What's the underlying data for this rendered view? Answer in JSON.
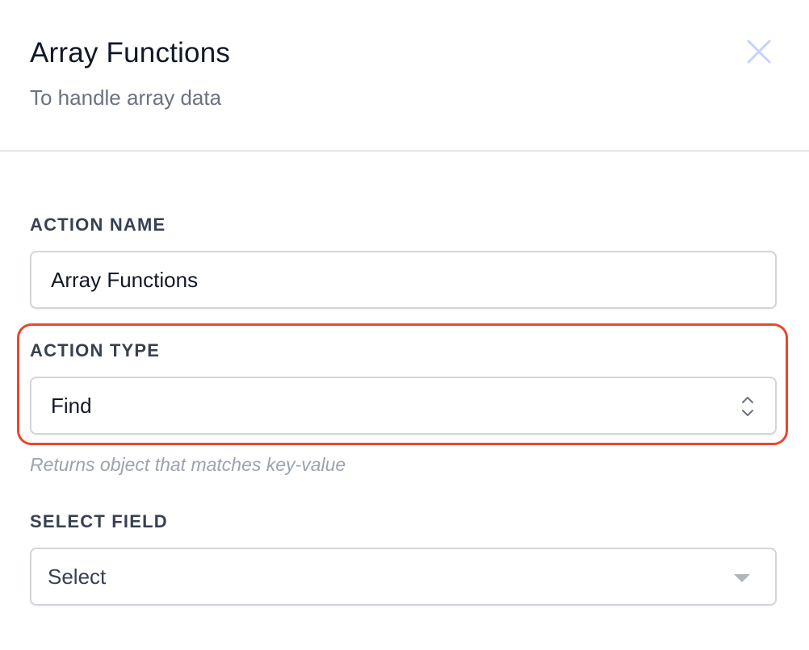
{
  "header": {
    "title": "Array Functions",
    "subtitle": "To handle array data",
    "close_icon": "close-icon"
  },
  "form": {
    "action_name": {
      "label": "ACTION NAME",
      "value": "Array Functions"
    },
    "action_type": {
      "label": "ACTION TYPE",
      "selected": "Find",
      "helper": "Returns object that matches key-value",
      "icon": "updown-chevron-icon"
    },
    "select_field": {
      "label": "SELECT FIELD",
      "placeholder": "Select",
      "icon": "caret-down-icon"
    }
  },
  "colors": {
    "highlight": "#e8472f",
    "border": "#d1d5db",
    "close_icon": "#c7d2fe",
    "muted_text": "#6b7280"
  }
}
